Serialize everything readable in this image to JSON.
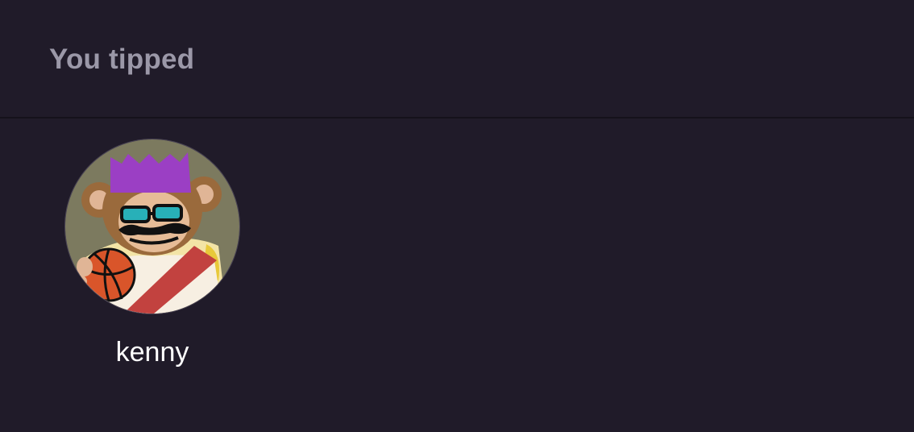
{
  "header": {
    "title": "You tipped"
  },
  "tipped_users": [
    {
      "username": "kenny",
      "avatar_icon": "monkey-king-avatar"
    }
  ],
  "colors": {
    "background": "#201b29",
    "title_text": "#9b98a8",
    "username_text": "#ffffff",
    "divider": "#15121b",
    "avatar_bg": "#7c7a5f",
    "crown": "#9b3fc4",
    "fur": "#9a6a3c",
    "sash": "#c2423f",
    "basketball": "#d9552a"
  }
}
